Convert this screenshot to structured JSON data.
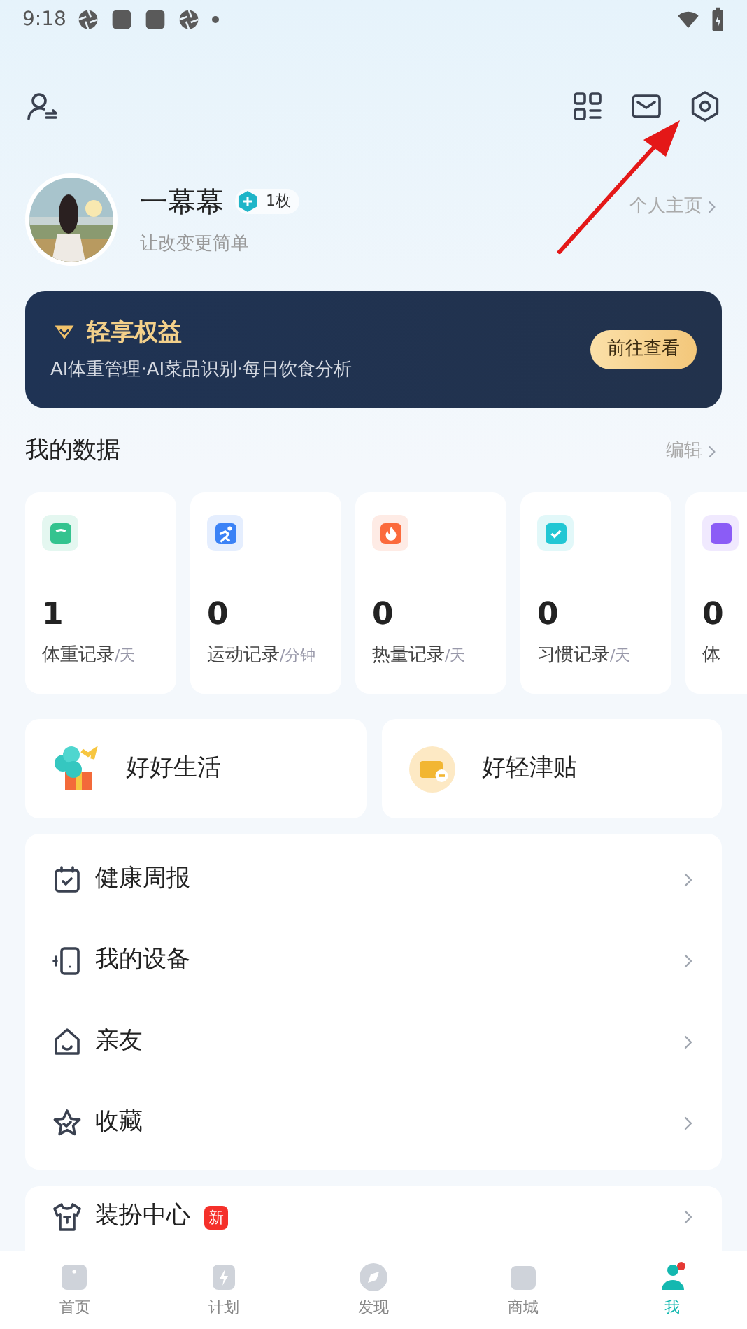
{
  "status_bar": {
    "time": "9:18"
  },
  "profile": {
    "name": "一幕幕",
    "badge_count": "1枚",
    "motto": "让改变更简单",
    "homepage_link": "个人主页"
  },
  "banner": {
    "title": "轻享权益",
    "subtitle": "AI体重管理·AI菜品识别·每日饮食分析",
    "button": "前往查看"
  },
  "my_data": {
    "title": "我的数据",
    "edit": "编辑",
    "stats": [
      {
        "value": "1",
        "label": "体重记录",
        "unit": "/天",
        "color": "#34c38f"
      },
      {
        "value": "0",
        "label": "运动记录",
        "unit": "/分钟",
        "color": "#3b82f6"
      },
      {
        "value": "0",
        "label": "热量记录",
        "unit": "/天",
        "color": "#fb6a3c"
      },
      {
        "value": "0",
        "label": "习惯记录",
        "unit": "/天",
        "color": "#22c7d4"
      },
      {
        "value": "0",
        "label": "体",
        "color": "#8b5cf6"
      }
    ]
  },
  "quick_cards": [
    {
      "label": "好好生活"
    },
    {
      "label": "好轻津贴"
    }
  ],
  "menu": [
    {
      "label": "健康周报"
    },
    {
      "label": "我的设备"
    },
    {
      "label": "亲友"
    },
    {
      "label": "收藏"
    }
  ],
  "menu_2": [
    {
      "label": "装扮中心",
      "badge": "新"
    }
  ],
  "bottom_nav": [
    {
      "label": "首页",
      "selected": false
    },
    {
      "label": "计划",
      "selected": false
    },
    {
      "label": "发现",
      "selected": false
    },
    {
      "label": "商城",
      "selected": false
    },
    {
      "label": "我",
      "selected": true
    }
  ]
}
